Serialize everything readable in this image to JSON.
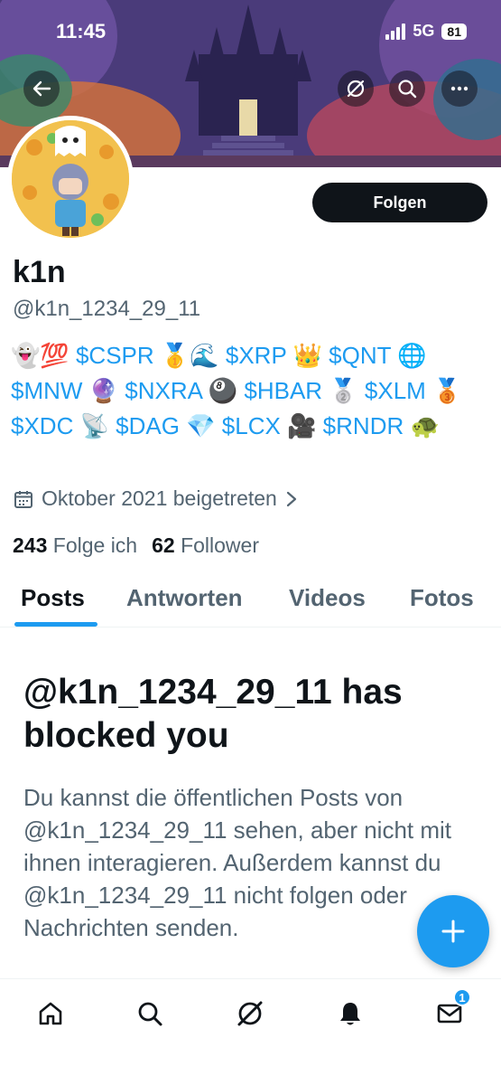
{
  "status_bar": {
    "time": "11:45",
    "network": "5G",
    "battery": "81"
  },
  "banner": {
    "description_icons": [
      "back-arrow-icon",
      "grok-icon",
      "search-icon",
      "more-icon"
    ]
  },
  "profile": {
    "display_name": "k1n",
    "handle": "@k1n_1234_29_11",
    "follow_label": "Folgen",
    "bio": [
      {
        "emoji": "👻💯"
      },
      {
        "tag": " $CSPR "
      },
      {
        "emoji": "🥇🌊"
      },
      {
        "tag": " $XRP "
      },
      {
        "emoji": "👑"
      },
      {
        "tag": " $QNT "
      },
      {
        "emoji": "🌐"
      },
      {
        "tag": " $MNW "
      },
      {
        "emoji": "🔮"
      },
      {
        "tag": " $NXRA "
      },
      {
        "emoji": "🎱"
      },
      {
        "tag": " $HBAR "
      },
      {
        "emoji": "🥈"
      },
      {
        "tag": " $XLM "
      },
      {
        "emoji": "🥉"
      },
      {
        "tag": " $XDC "
      },
      {
        "emoji": "📡"
      },
      {
        "tag": " $DAG "
      },
      {
        "emoji": "💎"
      },
      {
        "tag": " $LCX "
      },
      {
        "emoji": "🎥"
      },
      {
        "tag": " $RNDR "
      },
      {
        "emoji": "🐢"
      }
    ],
    "joined": "Oktober 2021 beigetreten",
    "following_count": "243",
    "following_label": "Folge ich",
    "followers_count": "62",
    "followers_label": "Follower"
  },
  "tabs": [
    {
      "label": "Posts",
      "active": true
    },
    {
      "label": "Antworten",
      "active": false
    },
    {
      "label": "Videos",
      "active": false
    },
    {
      "label": "Fotos",
      "active": false
    }
  ],
  "blocked": {
    "title": "@k1n_1234_29_11 has blocked you",
    "text": "Du kannst die öffentlichen Posts von @k1n_1234_29_11 sehen, aber nicht mit ihnen interagieren. Außerdem kannst du @k1n_1234_29_11 nicht folgen oder Nachrichten senden."
  },
  "bottom_nav": {
    "items": [
      "home-icon",
      "search-icon",
      "grok-icon",
      "notifications-icon",
      "messages-icon"
    ],
    "messages_badge": "1"
  },
  "colors": {
    "accent": "#1d9bf0",
    "text": "#0f1419",
    "secondary": "#536471"
  }
}
